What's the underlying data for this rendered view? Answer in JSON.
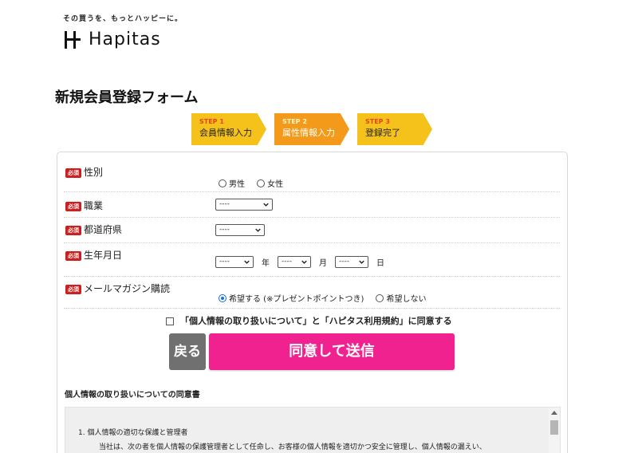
{
  "header": {
    "tagline": "その買うを、もっとハッピーに。",
    "brand": "Hapitas"
  },
  "page_title": "新規会員登録フォーム",
  "steps": [
    {
      "num": "STEP 1",
      "label": "会員情報入力"
    },
    {
      "num": "STEP 2",
      "label": "属性情報入力"
    },
    {
      "num": "STEP 3",
      "label": "登録完了"
    }
  ],
  "required_badge": "必須",
  "form": {
    "gender": {
      "label": "性別",
      "options": [
        "男性",
        "女性"
      ]
    },
    "occupation": {
      "label": "職業",
      "value": "----"
    },
    "prefecture": {
      "label": "都道府県",
      "value": "----"
    },
    "birthdate": {
      "label": "生年月日",
      "year": "----",
      "year_unit": "年",
      "month": "----",
      "month_unit": "月",
      "day": "----",
      "day_unit": "日"
    },
    "newsletter": {
      "label": "メールマガジン購読",
      "opt_in": "希望する (※プレゼントポイントつき)",
      "opt_out": "希望しない"
    }
  },
  "agreement_text": "「個人情報の取り扱いについて」と「ハピタス利用規約」に同意する",
  "buttons": {
    "back": "戻る",
    "submit": "同意して送信"
  },
  "consent": {
    "title": "個人情報の取り扱いについての同意書",
    "heading": "1. 個人情報の適切な保護と管理者",
    "paragraph": "当社は、次の者を個人情報の保護管理者として任命し、お客様の個人情報を適切かつ安全に管理し、個人情報の漏えい、"
  },
  "colors": {
    "accent": "#f0228f",
    "step_active": "#f39a1b",
    "step_inactive": "#f4c21a",
    "required": "#cf1e1e"
  }
}
